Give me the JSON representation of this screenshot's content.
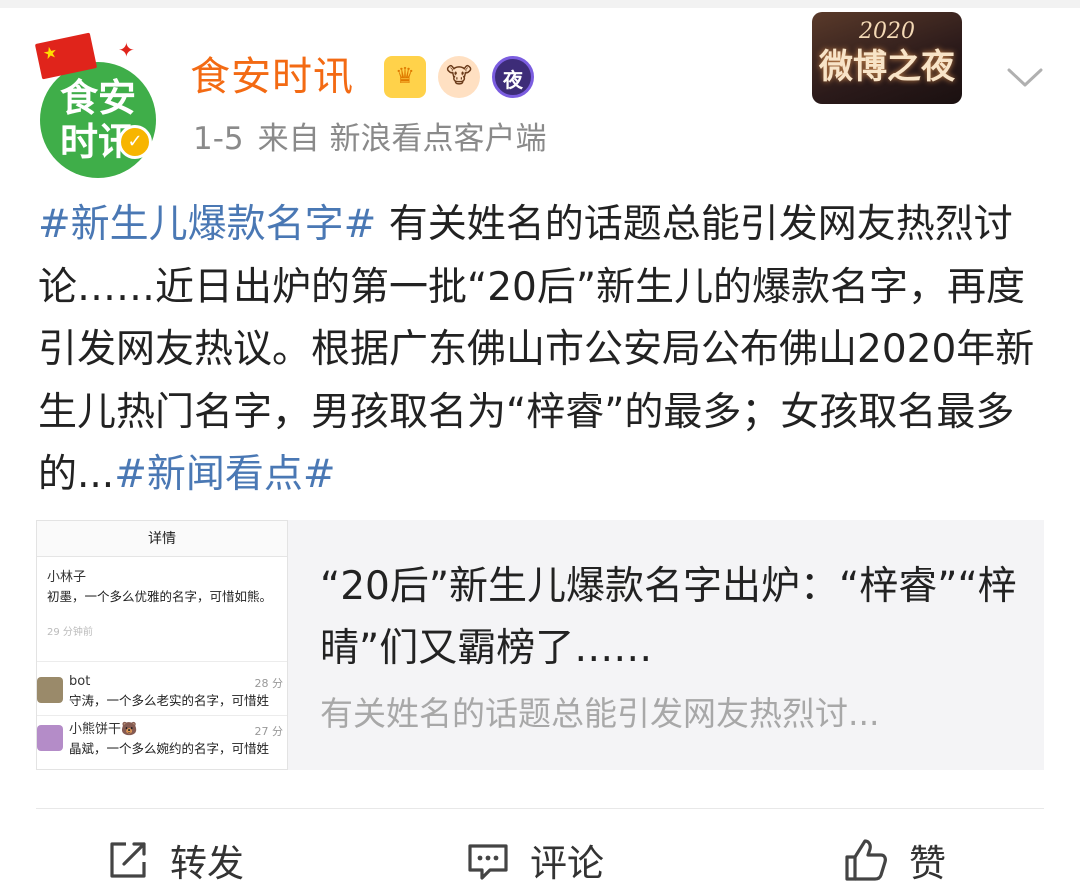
{
  "header": {
    "avatar_text": "食安\n时讯",
    "username": "食安时讯",
    "time": "1-5",
    "source": "来自 新浪看点客户端",
    "badge_night_label": "夜",
    "event_year": "2020",
    "event_name": "微博之夜"
  },
  "post": {
    "hashtag_1": "#新生儿爆款名字#",
    "text": " 有关姓名的话题总能引发网友热烈讨论……近日出炉的第一批“20后”新生儿的爆款名字，再度引发网友热议。根据广东佛山市公安局公布佛山2020年新生儿热门名字，男孩取名为“梓睿”的最多；女孩取名最多的...",
    "hashtag_2": "#新闻看点#"
  },
  "card": {
    "title": "“20后”新生儿爆款名字出炉：“梓睿”“梓晴”们又霸榜了……",
    "description": "有关姓名的话题总能引发网友热烈讨...",
    "thumb": {
      "header": "详情",
      "entries": [
        {
          "name": "小林子",
          "body": "初墨，一个多么优雅的名字，可惜如熊。",
          "time": "29 分钟前",
          "right": ""
        },
        {
          "name": "bot",
          "body": "守涛，一个多么老实的名字，可惜姓",
          "time": "",
          "right": "28 分"
        },
        {
          "name": "小熊饼干🐻",
          "body": "晶斌，一个多么婉约的名字，可惜姓",
          "time": "",
          "right": "27 分"
        }
      ]
    }
  },
  "actions": {
    "repost": "转发",
    "comment": "评论",
    "like": "赞"
  },
  "colors": {
    "username": "#f36a13",
    "hashtag": "#4a78b4",
    "meta": "#8a8a8a"
  },
  "icons": [
    "menu-chevron-down-icon",
    "repost-icon",
    "comment-icon",
    "like-icon",
    "verified-icon",
    "crown-badge-icon",
    "cow-badge-icon",
    "night-badge-icon"
  ]
}
